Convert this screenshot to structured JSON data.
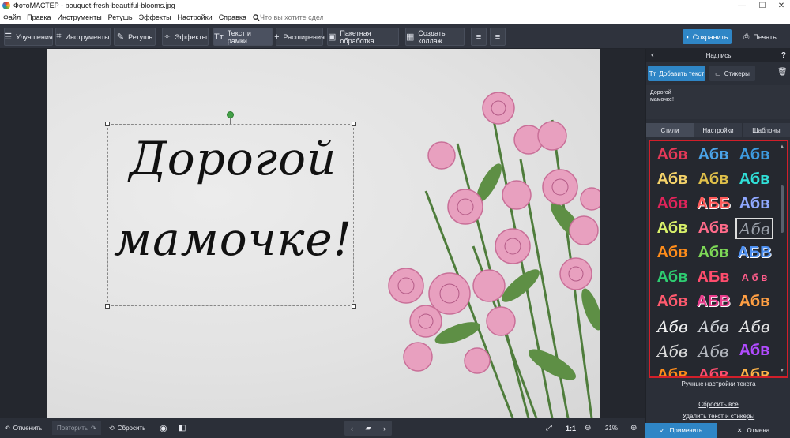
{
  "window": {
    "title": "ФотоМАСТЕР - bouquet-fresh-beautiful-blooms.jpg",
    "minimize": "—",
    "maximize": "☐",
    "close": "✕"
  },
  "menu": {
    "items": [
      "Файл",
      "Правка",
      "Инструменты",
      "Ретушь",
      "Эффекты",
      "Настройки",
      "Справка"
    ],
    "search_placeholder": "Что вы хотите сделать?"
  },
  "toolbar": {
    "improve": "Улучшения",
    "tools": "Инструменты",
    "retouch": "Ретушь",
    "effects": "Эффекты",
    "text": "Текст и рамки",
    "extensions": "Расширения",
    "batch": "Пакетная обработка",
    "collage": "Создать коллаж",
    "save": "Сохранить",
    "print": "Печать"
  },
  "canvas": {
    "caption_line1": "Дорогой",
    "caption_line2": "мамочке!"
  },
  "panel": {
    "title": "Надпись",
    "add_text": "Добавить текст",
    "stickers": "Стикеры",
    "text_value": "Дорогой\nмамочке!",
    "tabs": [
      "Стили",
      "Настройки",
      "Шаблоны"
    ],
    "styles": [
      {
        "t": "Абв",
        "c": "#e53958"
      },
      {
        "t": "Абв",
        "c": "#4aa3e8"
      },
      {
        "t": "Абв",
        "c": "#3d9be0"
      },
      {
        "t": "Абв",
        "c": "#f4d26a"
      },
      {
        "t": "Абв",
        "c": "#e0c04a"
      },
      {
        "t": "Абв",
        "c": "#30e0d8"
      },
      {
        "t": "Абв",
        "c": "#e0245a"
      },
      {
        "t": "АББ",
        "c": "#ff5a5a"
      },
      {
        "t": "Абв",
        "c": "#8fa8ff"
      },
      {
        "t": "Абв",
        "c": "#d8f06a"
      },
      {
        "t": "Абв",
        "c": "#ff6b8a"
      },
      {
        "t": "Абв",
        "c": "#9aa0aa"
      },
      {
        "t": "Абв",
        "c": "#ff8c1a"
      },
      {
        "t": "Абв",
        "c": "#7ed957"
      },
      {
        "t": "АБВ",
        "c": "#4d8ff0"
      },
      {
        "t": "Абв",
        "c": "#2ecc71"
      },
      {
        "t": "АБв",
        "c": "#ff4d6d"
      },
      {
        "t": "А б в",
        "c": "#ff5c8a"
      },
      {
        "t": "Абв",
        "c": "#ff5a6e"
      },
      {
        "t": "АБВ",
        "c": "#e83e8c"
      },
      {
        "t": "Абв",
        "c": "#ff9f43"
      },
      {
        "t": "Абв",
        "c": "#f2f2f2"
      },
      {
        "t": "Абв",
        "c": "#cfd3d8"
      },
      {
        "t": "Абв",
        "c": "#e6e6e6"
      },
      {
        "t": "Абв",
        "c": "#dcdcdc"
      },
      {
        "t": "Абв",
        "c": "#b5b9c0"
      },
      {
        "t": "Абв",
        "c": "#b14bff"
      },
      {
        "t": "Абв",
        "c": "#ff8c1a"
      },
      {
        "t": "Абв",
        "c": "#ff4d6d"
      },
      {
        "t": "Абв",
        "c": "#ffb347"
      }
    ],
    "selected_style": 11,
    "manual": "Ручные настройки текста",
    "reset_all": "Сбросить всё",
    "delete_all": "Удалить текст и стикеры",
    "apply": "Применить",
    "cancel": "Отмена"
  },
  "bottom": {
    "undo": "Отменить",
    "redo": "Повторить",
    "reset": "Сбросить",
    "ratio": "1:1",
    "zoom": "21%"
  },
  "colors": {
    "accent": "#2f86c6",
    "highlight": "#d11f2a"
  }
}
